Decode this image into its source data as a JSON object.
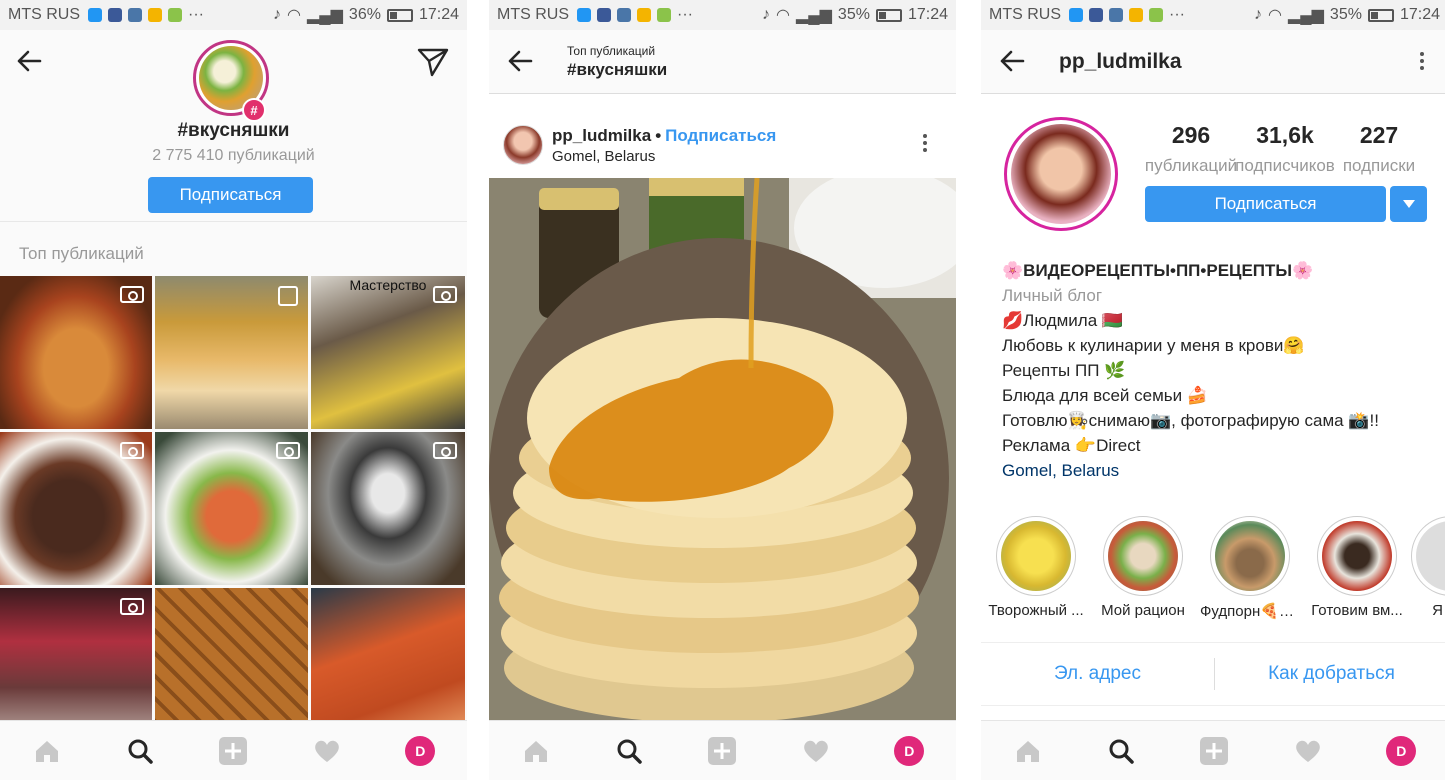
{
  "status_bars": [
    {
      "carrier": "MTS RUS",
      "battery": "36%",
      "time": "17:24",
      "battery_level": 0.36
    },
    {
      "carrier": "MTS RUS",
      "battery": "35%",
      "time": "17:24",
      "battery_level": 0.35
    },
    {
      "carrier": "MTS RUS",
      "battery": "35%",
      "time": "17:24",
      "battery_level": 0.35
    }
  ],
  "hashtag_page": {
    "name": "#вкусняшки",
    "count": "2 775 410 публикаций",
    "follow_label": "Подписаться",
    "section_title": "Топ публикаций",
    "tile_overlay_label": "Мастерство"
  },
  "post_page": {
    "subtitle": "Топ публикаций",
    "title": "#вкусняшки",
    "username": "pp_ludmilka",
    "dot": "•",
    "follow_label": "Подписаться",
    "location": "Gomel, Belarus"
  },
  "profile_page": {
    "username": "pp_ludmilka",
    "stats": [
      {
        "value": "296",
        "label": "публикаций"
      },
      {
        "value": "31,6k",
        "label": "подписчиков"
      },
      {
        "value": "227",
        "label": "подписки"
      }
    ],
    "follow_label": "Подписаться",
    "bio": {
      "name_line": "🌸ВИДЕОРЕЦЕПТЫ•ПП•РЕЦЕПТЫ🌸",
      "category": "Личный блог",
      "lines": [
        "💋Людмила 🇧🇾",
        "Любовь к кулинарии у меня в крови🤗",
        "Рецепты ПП 🌿",
        "Блюда для всей семьи 🍰",
        "Готовлю👩‍🍳снимаю📷, фотографирую сама 📸!!",
        "Реклама 👉Direct"
      ],
      "location": "Gomel, Belarus"
    },
    "highlights": [
      {
        "title": "Творожный ..."
      },
      {
        "title": "Мой рацион"
      },
      {
        "title": "Фудпорн🍕🍔🍟"
      },
      {
        "title": "Готовим вм..."
      },
      {
        "title": "Я и м"
      }
    ],
    "email_label": "Эл. адрес",
    "directions_label": "Как добраться"
  },
  "colors": {
    "accent_blue": "#3897f0",
    "hashtag_badge": "#e1306c",
    "profile_avatar_nav": "#e0287a"
  },
  "icons": {
    "nav": [
      "home-icon",
      "search-icon",
      "add-icon",
      "heart-icon",
      "profile-avatar"
    ]
  }
}
